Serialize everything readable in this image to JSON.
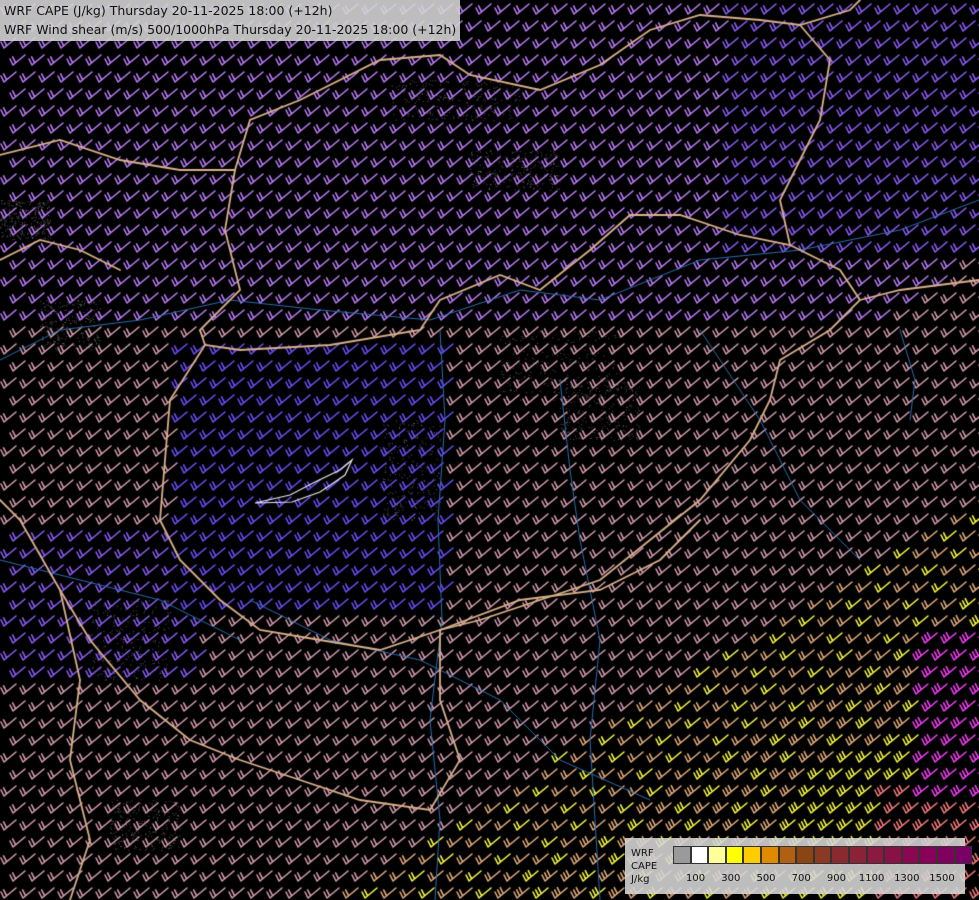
{
  "header": {
    "title1": "WRF CAPE (J/kg) Thursday 20-11-2025 18:00 (+12h)",
    "title2": "WRF Wind shear (m/s) 500/1000hPa Thursday 20-11-2025 18:00 (+12h)"
  },
  "legend": {
    "model": "WRF",
    "variable": "CAPE",
    "unit": "J/kg",
    "colors": [
      "#9a9a9a",
      "#ffffff",
      "#ffff99",
      "#ffff00",
      "#ffcc00",
      "#e08a00",
      "#b06010",
      "#8b4513",
      "#8a3a22",
      "#8a2a30",
      "#8a2238",
      "#8a1a40",
      "#8a1048",
      "#8a0850",
      "#880058",
      "#800060",
      "#7a0068"
    ],
    "tick_labels": [
      "100",
      "300",
      "500",
      "700",
      "900",
      "1100",
      "1300",
      "1500"
    ]
  },
  "map": {
    "barb_palette": [
      "#c080ff",
      "#9060ff",
      "#7050ff",
      "#d9a0b0",
      "#e8b080",
      "#ffff40",
      "#ff8080",
      "#ff40ff"
    ]
  }
}
